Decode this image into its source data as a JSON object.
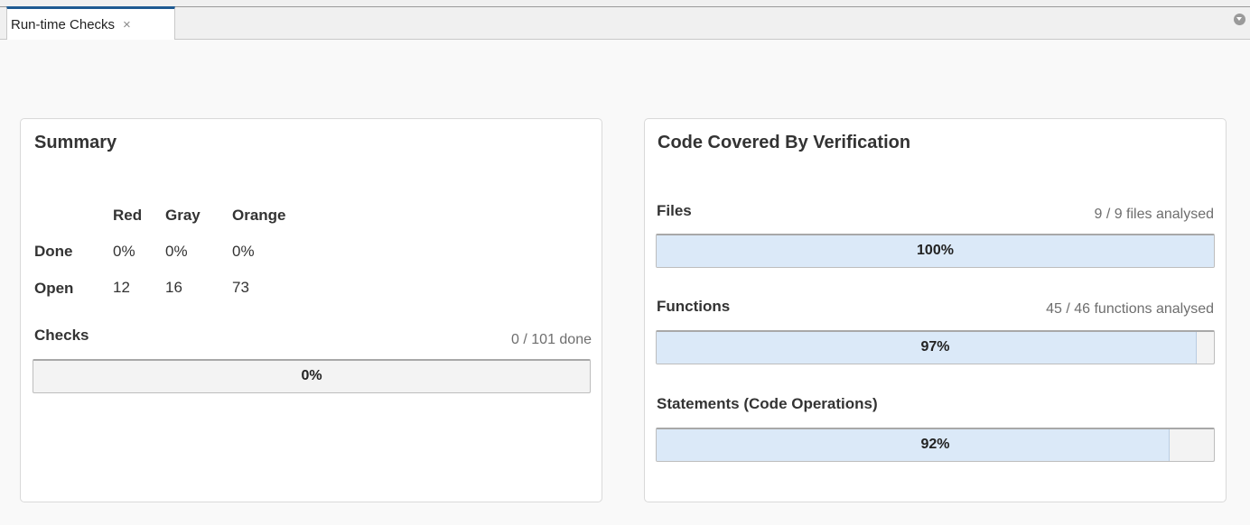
{
  "tabs": [
    {
      "label": "Run-time Checks",
      "close": "×"
    }
  ],
  "summary": {
    "title": "Summary",
    "columns": [
      "Red",
      "Gray",
      "Orange"
    ],
    "rows": [
      {
        "label": "Done",
        "values": [
          "0%",
          "0%",
          "0%"
        ]
      },
      {
        "label": "Open",
        "values": [
          "12",
          "16",
          "73"
        ]
      }
    ],
    "checks": {
      "label": "Checks",
      "meta": "0 / 101 done",
      "progress": 0,
      "progress_text": "0%"
    }
  },
  "coverage": {
    "title": "Code Covered By Verification",
    "files": {
      "label": "Files",
      "meta": "9 / 9 files analysed",
      "progress": 1.0,
      "progress_text": "100%"
    },
    "functions": {
      "label": "Functions",
      "meta": "45 / 46 functions analysed",
      "progress": 0.97,
      "progress_text": "97%"
    },
    "statements": {
      "label": "Statements (Code Operations)",
      "progress": 0.92,
      "progress_text": "92%"
    }
  },
  "colors": {
    "tab_accent": "#1e5a92",
    "progress_fill": "#dbe9f8",
    "progress_track": "#f3f3f3"
  },
  "icons": {
    "tab_close": "close-icon",
    "tab_menu": "tab-menu-chevron-icon"
  }
}
